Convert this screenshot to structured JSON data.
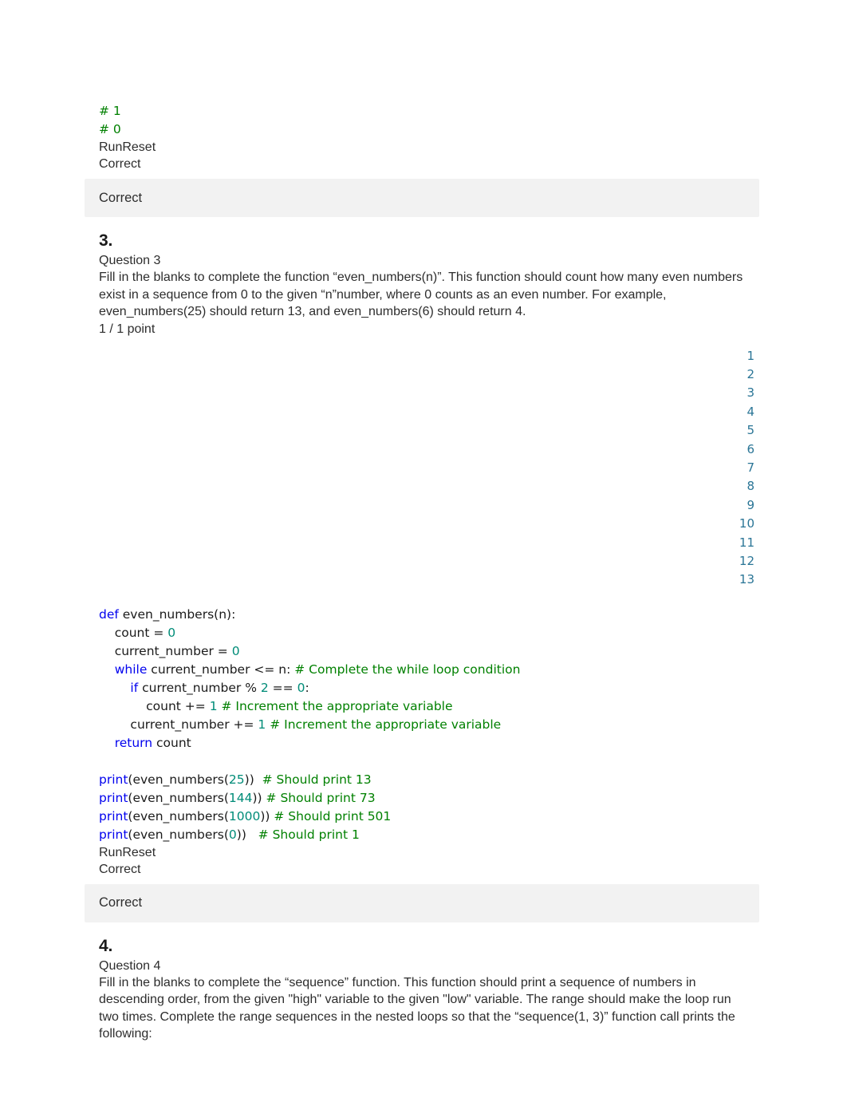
{
  "question2_tail": {
    "output_lines": [
      "# 1",
      "# 0"
    ],
    "run_reset_label": "RunReset",
    "status_label": "Correct",
    "banner_label": "Correct"
  },
  "question3": {
    "number": "3.",
    "label": "Question 3",
    "prompt": "Fill in the blanks to complete the function “even_numbers(n)”. This function should count how many even numbers exist in a sequence from 0 to the given “n”number, where 0 counts as an even number. For example, even_numbers(25) should return 13, and even_numbers(6) should return 4.",
    "points": "1 / 1 point",
    "line_numbers": [
      "1",
      "2",
      "3",
      "4",
      "5",
      "6",
      "7",
      "8",
      "9",
      "10",
      "11",
      "12",
      "13"
    ],
    "code": [
      {
        "indent": 0,
        "tokens": [
          {
            "t": "def ",
            "c": "kw"
          },
          {
            "t": "even_numbers(n):",
            "c": "plain"
          }
        ]
      },
      {
        "indent": 1,
        "tokens": [
          {
            "t": "count = ",
            "c": "plain"
          },
          {
            "t": "0",
            "c": "num"
          }
        ]
      },
      {
        "indent": 1,
        "tokens": [
          {
            "t": "current_number = ",
            "c": "plain"
          },
          {
            "t": "0",
            "c": "num"
          }
        ]
      },
      {
        "indent": 1,
        "tokens": [
          {
            "t": "while ",
            "c": "kw"
          },
          {
            "t": "current_number <= n: ",
            "c": "plain"
          },
          {
            "t": "# Complete the while loop condition",
            "c": "cmt"
          }
        ]
      },
      {
        "indent": 2,
        "tokens": [
          {
            "t": "if ",
            "c": "kw"
          },
          {
            "t": "current_number % ",
            "c": "plain"
          },
          {
            "t": "2",
            "c": "num"
          },
          {
            "t": " == ",
            "c": "plain"
          },
          {
            "t": "0",
            "c": "num"
          },
          {
            "t": ":",
            "c": "plain"
          }
        ]
      },
      {
        "indent": 3,
        "tokens": [
          {
            "t": "count += ",
            "c": "plain"
          },
          {
            "t": "1",
            "c": "num"
          },
          {
            "t": " ",
            "c": "plain"
          },
          {
            "t": "# Increment the appropriate variable",
            "c": "cmt"
          }
        ]
      },
      {
        "indent": 2,
        "tokens": [
          {
            "t": "current_number += ",
            "c": "plain"
          },
          {
            "t": "1",
            "c": "num"
          },
          {
            "t": " ",
            "c": "plain"
          },
          {
            "t": "# Increment the appropriate variable",
            "c": "cmt"
          }
        ]
      },
      {
        "indent": 1,
        "tokens": [
          {
            "t": "return ",
            "c": "kw"
          },
          {
            "t": "count",
            "c": "plain"
          }
        ]
      },
      {
        "indent": 0,
        "tokens": [
          {
            "t": "",
            "c": "plain"
          }
        ]
      },
      {
        "indent": 0,
        "tokens": [
          {
            "t": "print",
            "c": "kw"
          },
          {
            "t": "(even_numbers(",
            "c": "plain"
          },
          {
            "t": "25",
            "c": "num"
          },
          {
            "t": "))  ",
            "c": "plain"
          },
          {
            "t": "# Should print 13",
            "c": "cmt"
          }
        ]
      },
      {
        "indent": 0,
        "tokens": [
          {
            "t": "print",
            "c": "kw"
          },
          {
            "t": "(even_numbers(",
            "c": "plain"
          },
          {
            "t": "144",
            "c": "num"
          },
          {
            "t": ")) ",
            "c": "plain"
          },
          {
            "t": "# Should print 73",
            "c": "cmt"
          }
        ]
      },
      {
        "indent": 0,
        "tokens": [
          {
            "t": "print",
            "c": "kw"
          },
          {
            "t": "(even_numbers(",
            "c": "plain"
          },
          {
            "t": "1000",
            "c": "num"
          },
          {
            "t": ")) ",
            "c": "plain"
          },
          {
            "t": "# Should print 501",
            "c": "cmt"
          }
        ]
      },
      {
        "indent": 0,
        "tokens": [
          {
            "t": "print",
            "c": "kw"
          },
          {
            "t": "(even_numbers(",
            "c": "plain"
          },
          {
            "t": "0",
            "c": "num"
          },
          {
            "t": "))   ",
            "c": "plain"
          },
          {
            "t": "# Should print 1",
            "c": "cmt"
          }
        ]
      }
    ],
    "run_reset_label": "RunReset",
    "status_label": "Correct",
    "banner_label": "Correct"
  },
  "question4": {
    "number": "4.",
    "label": "Question 4",
    "prompt": "Fill in the blanks to complete the “sequence” function. This function should print a sequence of numbers in descending order, from the given \"high\" variable to the given \"low\" variable. The range should make the loop run two times. Complete the range sequences in the nested loops so that the “sequence(1, 3)” function call prints the following:"
  },
  "colors": {
    "comment": "#008000",
    "keyword": "#0000ee",
    "number": "#008c78",
    "line_number": "#2a7596",
    "banner_bg": "#f2f2f2",
    "text": "#2d2d2d"
  }
}
